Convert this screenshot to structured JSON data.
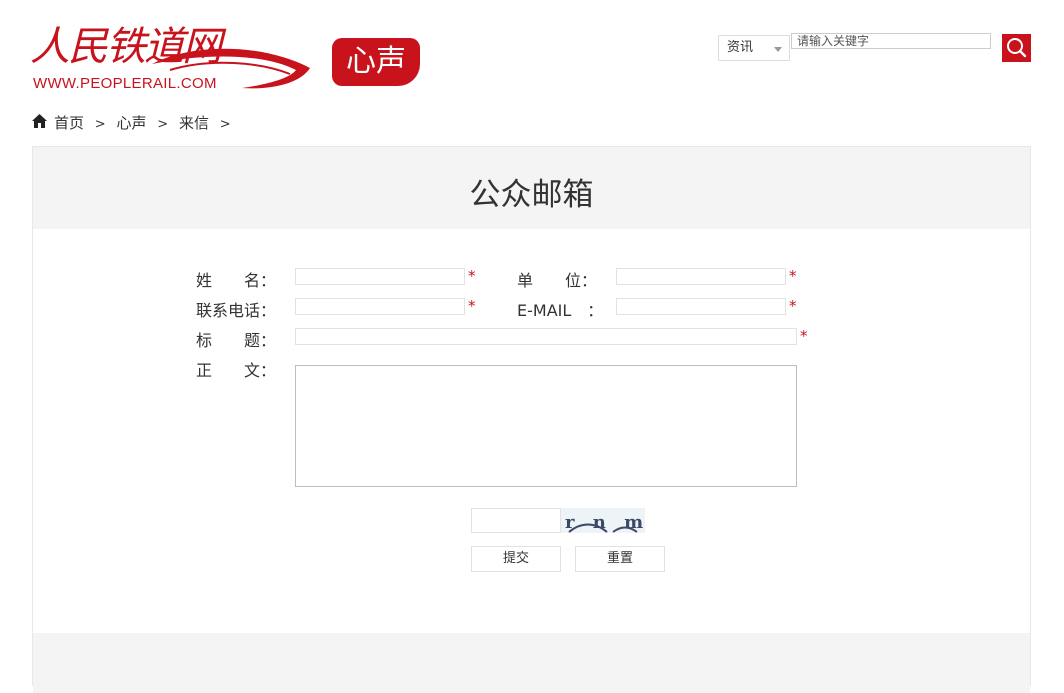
{
  "logo": {
    "name_cn": "人民铁道网",
    "url_text": "WWW.PEOPLERAIL.COM"
  },
  "section_badge": "心声",
  "search": {
    "category": "资讯",
    "placeholder": "请输入关键字"
  },
  "breadcrumb": {
    "home": "首页",
    "sep1": ">",
    "item1": "心声",
    "sep2": ">",
    "item2": "来信",
    "sep3": ">"
  },
  "panel": {
    "title": "公众邮箱"
  },
  "form": {
    "name_label": "姓　　名：",
    "unit_label": "单　　位：",
    "phone_label": "联系电话：",
    "email_label": "E-MAIL　：",
    "subject_label": "标　　题：",
    "body_label": "正　　文：",
    "required_mark": "*",
    "captcha_text": "r n m d",
    "submit_label": "提交",
    "reset_label": "重置"
  },
  "colors": {
    "brand_red": "#c8121c",
    "panel_gray": "#f4f4f4"
  }
}
